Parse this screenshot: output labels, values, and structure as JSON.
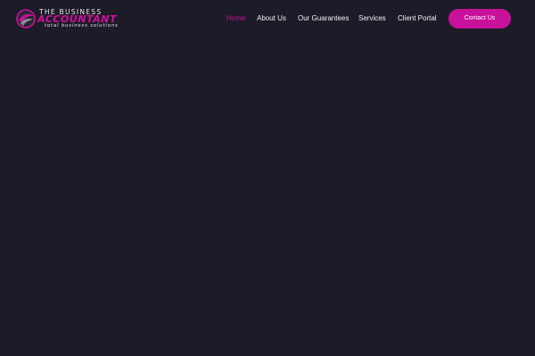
{
  "logo": {
    "line1": "THE BUSINESS",
    "line2": "ACCOUNTANT",
    "line3": "total business solutions"
  },
  "nav": {
    "items": [
      {
        "label": "Home",
        "active": true
      },
      {
        "label": "About Us",
        "active": false
      },
      {
        "label": "Our Guarantees",
        "active": false
      },
      {
        "label": "Services",
        "active": false
      },
      {
        "label": "Client Portal",
        "active": false
      }
    ],
    "contact_label": "Contact Us"
  },
  "colors": {
    "background": "#1d1b27",
    "accent": "#c8119a",
    "nav_text": "#f2f1f6",
    "nav_active": "#c01597"
  },
  "icons": {
    "logo_mark": "circular-swoosh-logo-icon"
  }
}
